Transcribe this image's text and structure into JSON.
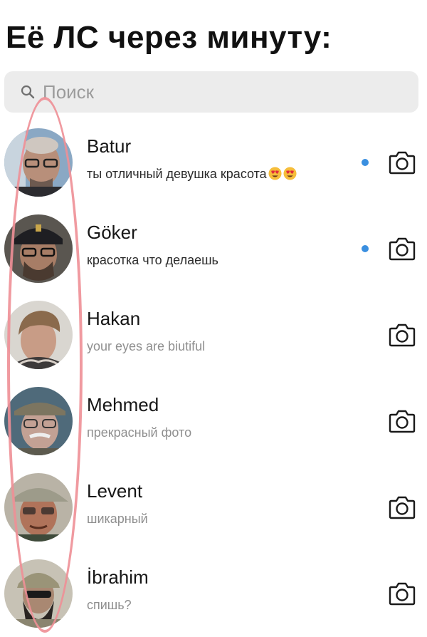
{
  "caption": "Её ЛС через минуту:",
  "search": {
    "placeholder": "Поиск",
    "icon": "search-icon"
  },
  "colors": {
    "unread_dot": "#3a8fe0",
    "highlight_oval": "#ee8f96",
    "search_bg": "#ececec"
  },
  "chats": [
    {
      "name": "Batur",
      "preview": "ты отличный девушка красота",
      "emoji": "heart-eyes-emoji x2",
      "unread": true
    },
    {
      "name": "Göker",
      "preview": "красотка что делаешь",
      "unread": true
    },
    {
      "name": "Hakan",
      "preview": "your eyes are biutiful",
      "unread": false
    },
    {
      "name": "Mehmed",
      "preview": "прекрасный фото",
      "unread": false
    },
    {
      "name": "Levent",
      "preview": "шикарный",
      "unread": false
    },
    {
      "name": "İbrahim",
      "preview": "спишь?",
      "unread": false
    }
  ]
}
